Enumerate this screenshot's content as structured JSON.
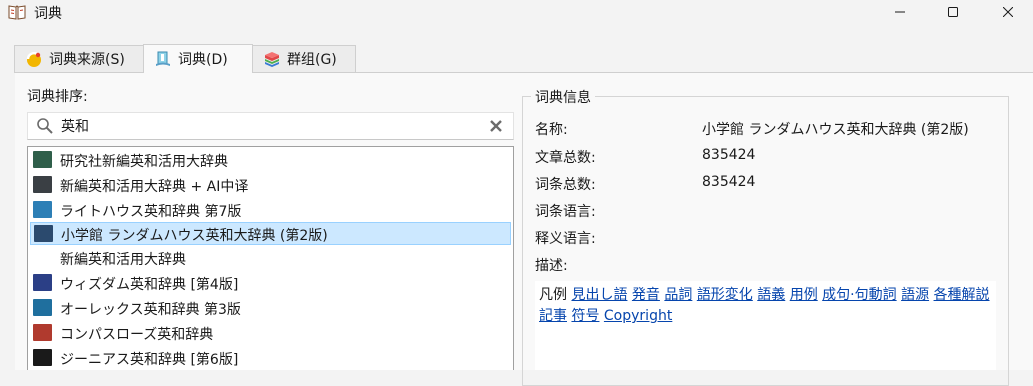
{
  "window": {
    "title": "词典"
  },
  "tabs": [
    {
      "label": "词典来源(S)",
      "icon": "sources-icon"
    },
    {
      "label": "词典(D)",
      "icon": "dictionary-icon",
      "active": true
    },
    {
      "label": "群组(G)",
      "icon": "groups-icon"
    }
  ],
  "order_label": "词典排序:",
  "search": {
    "value": "英和",
    "placeholder": ""
  },
  "dictionaries": [
    {
      "label": "研究社新編英和活用大辞典",
      "color": "#2f5f4a"
    },
    {
      "label": "新編英和活用大辞典 + AI中译",
      "color": "#3a3f44"
    },
    {
      "label": "ライトハウス英和辞典 第7版",
      "color": "#2d7fb6"
    },
    {
      "label": "小学館 ランダムハウス英和大辞典 (第2版)",
      "color": "#2b4a6e",
      "selected": true
    },
    {
      "label": "新編英和活用大辞典",
      "color": null
    },
    {
      "label": "ウィズダム英和辞典 [第4版]",
      "color": "#2b3f86"
    },
    {
      "label": "オーレックス英和辞典 第3版",
      "color": "#1f6f9e"
    },
    {
      "label": "コンパスローズ英和辞典",
      "color": "#b03a2e"
    },
    {
      "label": "ジーニアス英和辞典 [第6版]",
      "color": "#1a1a1a"
    }
  ],
  "info": {
    "legend": "词典信息",
    "name_label": "名称:",
    "name_value": "小学館 ランダムハウス英和大辞典 (第2版)",
    "articles_label": "文章总数:",
    "articles_value": "835424",
    "entries_label": "词条总数:",
    "entries_value": "835424",
    "entry_lang_label": "词条语言:",
    "entry_lang_value": "",
    "def_lang_label": "释义语言:",
    "def_lang_value": "",
    "desc_label": "描述:",
    "desc_prefix": "凡例",
    "desc_links": [
      "見出し語",
      "発音",
      "品詞",
      "語形変化",
      "語義",
      "用例",
      "成句·句動詞",
      "語源",
      "各種解説記事",
      "符号",
      "Copyright"
    ]
  }
}
